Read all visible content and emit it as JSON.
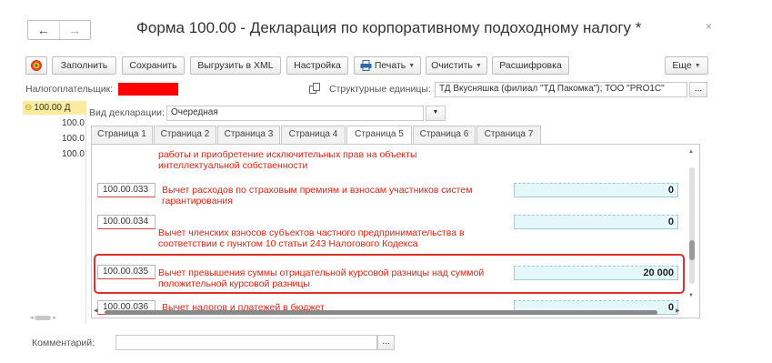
{
  "window": {
    "title": "Форма 100.00 - Декларация по корпоративному подоходному налогу *",
    "back_icon": "←",
    "forward_icon": "→",
    "close_icon": "×"
  },
  "toolbar": {
    "fill": "Заполнить",
    "save": "Сохранить",
    "export_xml": "Выгрузить в XML",
    "settings": "Настройка",
    "print": "Печать",
    "clear": "Очистить",
    "decode": "Расшифровка",
    "more": "Еще"
  },
  "header": {
    "taxpayer_label": "Налогоплательщик:",
    "struct_units_label": "Структурные единицы:",
    "struct_units_value": "ТД Вкусняшка (филиал \"ТД Пакомка\"); ТОО \"PRO1C\"",
    "decl_type_label": "Вид декларации:",
    "decl_type_value": "Очередная",
    "ellipsis": "..."
  },
  "left_list": {
    "items": [
      "100.00 Д",
      "100.0",
      "100.0",
      "100.0"
    ]
  },
  "tabs": [
    "Страница 1",
    "Страница 2",
    "Страница 3",
    "Страница 4",
    "Страница 5",
    "Страница 6",
    "Страница 7"
  ],
  "rows": [
    {
      "code": "",
      "text": "работы и приобретение исключительных прав на объекты интеллектуальной собственности",
      "value": ""
    },
    {
      "code": "100.00.033",
      "text": "Вычет расходов по страховым премиям и взносам участников систем гарантирования",
      "value": "0"
    },
    {
      "code": "100.00.034",
      "text": "Вычет членских взносов субъектов частного предпринимательства в соответствии с пунктом 10 статьи 243 Налогового Кодекса",
      "value": "0"
    },
    {
      "code": "100.00.035",
      "text": "Вычет превышения суммы отрицательной курсовой разницы над суммой положительной курсовой разницы",
      "value": "20 000"
    },
    {
      "code": "100.00.036",
      "text": "Вычет налогов и платежей в бюджет",
      "value": "0"
    }
  ],
  "footer": {
    "comment_label": "Комментарий:",
    "ellipsis": "..."
  },
  "colors": {
    "highlight": "#e03030",
    "value_bg": "#e4f7fa",
    "red_text": "#e8200f"
  }
}
